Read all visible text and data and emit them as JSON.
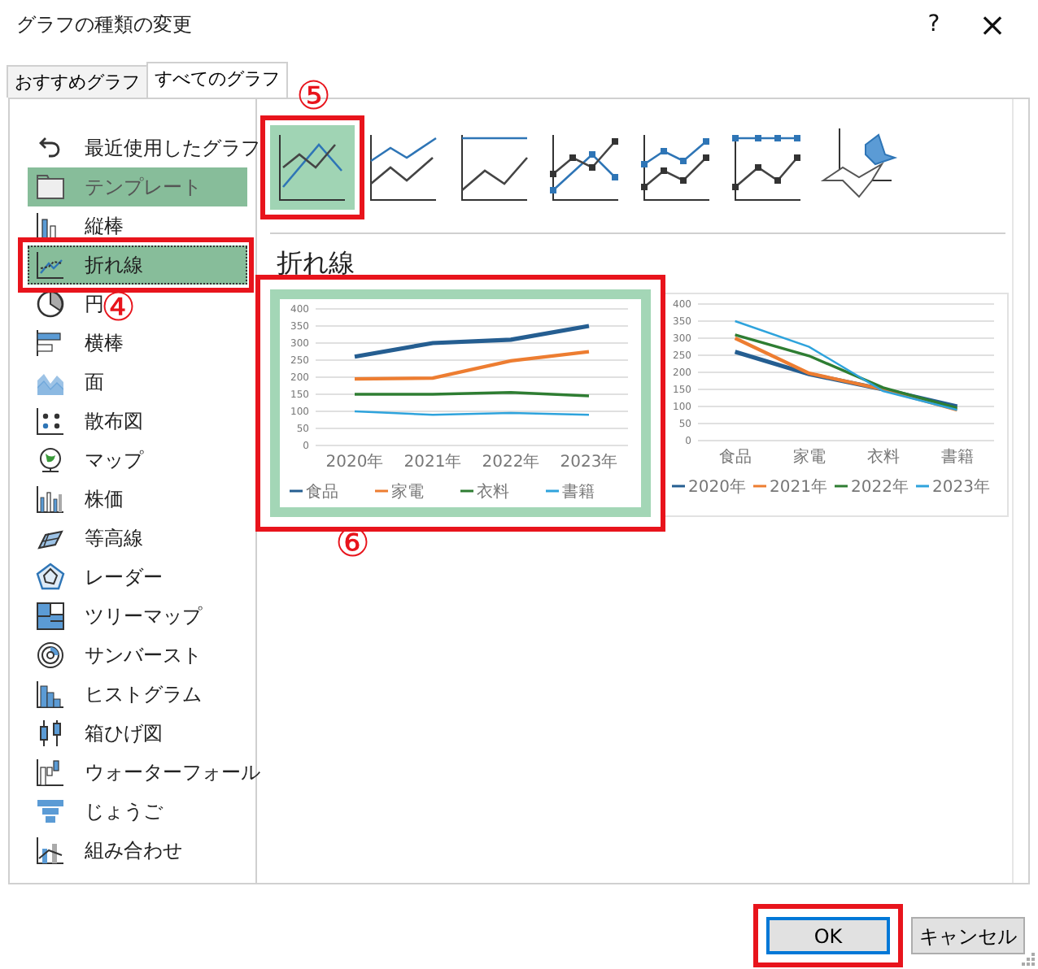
{
  "window": {
    "title": "グラフの種類の変更",
    "help": "?",
    "close": "×"
  },
  "tabs": [
    {
      "label": "おすすめグラフ",
      "selected": false
    },
    {
      "label": "すべてのグラフ",
      "selected": true
    }
  ],
  "chart_types": [
    {
      "label": "最近使用したグラフ",
      "selected": false
    },
    {
      "label": "テンプレート",
      "selected": false,
      "hovered": true
    },
    {
      "label": "縦棒",
      "selected": false
    },
    {
      "label": "折れ線",
      "selected": true,
      "marked": true
    },
    {
      "label": "円",
      "selected": false
    },
    {
      "label": "横棒",
      "selected": false
    },
    {
      "label": "面",
      "selected": false
    },
    {
      "label": "散布図",
      "selected": false
    },
    {
      "label": "マップ",
      "selected": false
    },
    {
      "label": "株価",
      "selected": false
    },
    {
      "label": "等高線",
      "selected": false
    },
    {
      "label": "レーダー",
      "selected": false
    },
    {
      "label": "ツリーマップ",
      "selected": false
    },
    {
      "label": "サンバースト",
      "selected": false
    },
    {
      "label": "ヒストグラム",
      "selected": false
    },
    {
      "label": "箱ひげ図",
      "selected": false
    },
    {
      "label": "ウォーターフォール",
      "selected": false
    },
    {
      "label": "じょうご",
      "selected": false
    },
    {
      "label": "組み合わせ",
      "selected": false
    }
  ],
  "subtypes": [
    {
      "selected": true,
      "marked": true
    },
    {
      "selected": false
    },
    {
      "selected": false
    },
    {
      "selected": false
    },
    {
      "selected": false
    },
    {
      "selected": false
    },
    {
      "selected": false
    }
  ],
  "subtype_title": "折れ線",
  "previews": [
    {
      "selected": true,
      "marked": true,
      "chart_data": {
        "type": "line",
        "categories": [
          "2020年",
          "2021年",
          "2022年",
          "2023年"
        ],
        "ylim": [
          0,
          400
        ],
        "yticks": [
          0,
          50,
          100,
          150,
          200,
          250,
          300,
          350,
          400
        ],
        "grid": true,
        "legend": true,
        "series": [
          {
            "name": "食品",
            "color": "#255e91",
            "values": [
              260,
              300,
              310,
              350
            ]
          },
          {
            "name": "家電",
            "color": "#ed7d31",
            "values": [
              195,
              197,
              248,
              275
            ]
          },
          {
            "name": "衣料",
            "color": "#2e7d32",
            "values": [
              150,
              150,
              155,
              145
            ]
          },
          {
            "name": "書籍",
            "color": "#2ea3dc",
            "values": [
              100,
              90,
              95,
              90
            ]
          }
        ]
      }
    },
    {
      "selected": false,
      "chart_data": {
        "type": "line",
        "categories": [
          "食品",
          "家電",
          "衣料",
          "書籍"
        ],
        "ylim": [
          0,
          400
        ],
        "yticks": [
          0,
          50,
          100,
          150,
          200,
          250,
          300,
          350,
          400
        ],
        "grid": true,
        "legend": true,
        "series": [
          {
            "name": "2020年",
            "color": "#255e91",
            "values": [
              260,
              195,
              150,
              100
            ]
          },
          {
            "name": "2021年",
            "color": "#ed7d31",
            "values": [
              300,
              197,
              150,
              90
            ]
          },
          {
            "name": "2022年",
            "color": "#2e7d32",
            "values": [
              310,
              248,
              155,
              95
            ]
          },
          {
            "name": "2023年",
            "color": "#2ea3dc",
            "values": [
              350,
              275,
              145,
              90
            ]
          }
        ]
      }
    }
  ],
  "buttons": [
    {
      "label": "OK",
      "default": true,
      "marked": true
    },
    {
      "label": "キャンセル",
      "default": false
    }
  ],
  "callouts": [
    {
      "text": "⑤"
    },
    {
      "text": "④"
    },
    {
      "text": "⑥"
    }
  ]
}
